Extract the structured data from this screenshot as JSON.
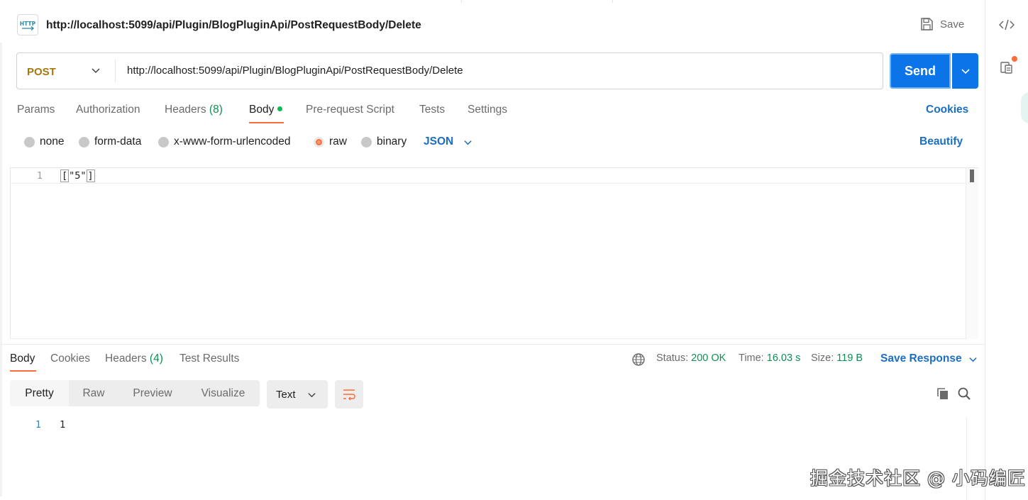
{
  "header": {
    "icon_label": "HTTP",
    "title": "http://localhost:5099/api/Plugin/BlogPluginApi/PostRequestBody/Delete",
    "save_label": "Save"
  },
  "request": {
    "method": "POST",
    "url": "http://localhost:5099/api/Plugin/BlogPluginApi/PostRequestBody/Delete",
    "send_label": "Send"
  },
  "request_tabs": {
    "params": "Params",
    "authorization": "Authorization",
    "headers": "Headers",
    "headers_count": "(8)",
    "body": "Body",
    "prerequest": "Pre-request Script",
    "tests": "Tests",
    "settings": "Settings",
    "cookies_link": "Cookies"
  },
  "body_types": {
    "none": "none",
    "form_data": "form-data",
    "urlencoded": "x-www-form-urlencoded",
    "raw": "raw",
    "binary": "binary",
    "selected": "raw",
    "format": "JSON",
    "beautify_link": "Beautify"
  },
  "editor": {
    "line_number": "1",
    "open_bracket": "[",
    "content": "\"5\"",
    "close_bracket": "]"
  },
  "response_tabs": {
    "body": "Body",
    "cookies": "Cookies",
    "headers": "Headers",
    "headers_count": "(4)",
    "test_results": "Test Results"
  },
  "response_status": {
    "status_label": "Status:",
    "status_value": "200 OK",
    "time_label": "Time:",
    "time_value": "16.03 s",
    "size_label": "Size:",
    "size_value": "119 B",
    "save_response": "Save Response"
  },
  "response_view": {
    "modes": [
      "Pretty",
      "Raw",
      "Preview",
      "Visualize"
    ],
    "active_mode": "Pretty",
    "format": "Text",
    "line_number": "1",
    "content": "1"
  },
  "watermark": "掘金技术社区 @ 小码编匠",
  "colors": {
    "accent_orange": "#ff6c37",
    "send_blue": "#0a74e8",
    "link_blue": "#1b6ec2",
    "status_green": "#0c8f54",
    "method_post": "#a6780a"
  }
}
